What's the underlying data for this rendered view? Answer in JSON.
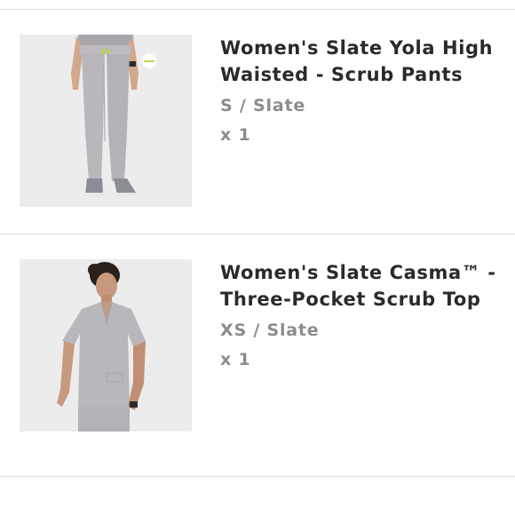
{
  "cart": {
    "items": [
      {
        "name": "Women's Slate Yola High Waisted - Scrub Pants",
        "variant": "S / Slate",
        "quantity": "x 1",
        "image_icon": "scrub-pants-photo"
      },
      {
        "name": "Women's Slate Casma™ - Three-Pocket Scrub Top",
        "variant": "XS / Slate",
        "quantity": "x 1",
        "image_icon": "scrub-top-photo"
      }
    ]
  },
  "colors": {
    "slate": "#b9b7bb",
    "background": "#ffffff",
    "divider": "#dcdcdc",
    "title_text": "#2a2a2a",
    "meta_text": "#8c8c8c"
  }
}
